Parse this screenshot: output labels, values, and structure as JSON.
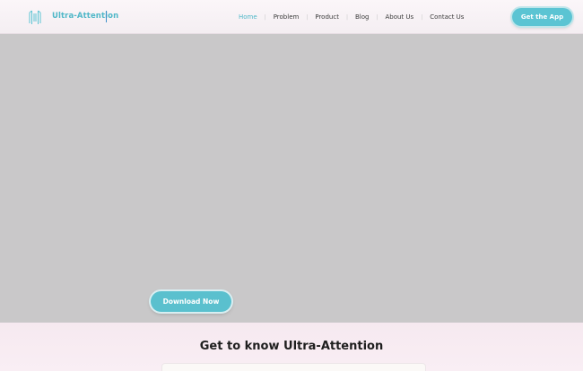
{
  "header": {
    "brand": "Ultra-Attention",
    "nav": [
      {
        "label": "Home",
        "active": true
      },
      {
        "label": "Problem",
        "active": false
      },
      {
        "label": "Product",
        "active": false
      },
      {
        "label": "Blog",
        "active": false
      },
      {
        "label": "About Us",
        "active": false
      },
      {
        "label": "Contact Us",
        "active": false
      }
    ],
    "nav_separator": "|",
    "cta_label": "Get the App"
  },
  "hero": {
    "download_label": "Download Now"
  },
  "intro": {
    "title": "Get to know Ultra-Attention"
  },
  "colors": {
    "accent": "#5bc4d3",
    "hero_background": "#c9c8c9",
    "page_background": "#f7eef3"
  },
  "icons": {
    "logo": "ultra-attention-logo-icon"
  }
}
